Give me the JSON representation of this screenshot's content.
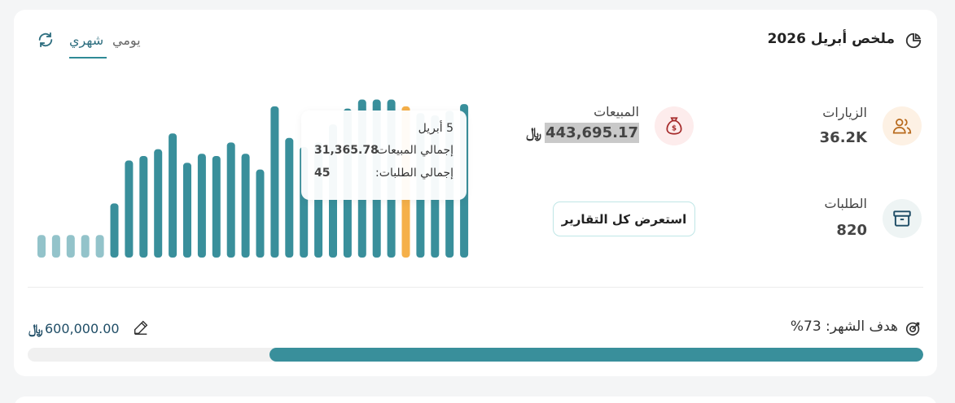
{
  "summary": {
    "title": "ملخص أبريل 2026",
    "tabs": [
      "يومي",
      "شهري"
    ],
    "active_tab": "شهري"
  },
  "stats": {
    "visits_label": "الزيارات",
    "visits_value": "36.2K",
    "sales_label": "المبيعات",
    "sales_value": "443,695.17",
    "orders_label": "الطلبات",
    "orders_value": "820"
  },
  "report_button_label": "استعرض كل التقارير",
  "tooltip": {
    "date": "5 أبريل",
    "sales_label": "إجمالي المبيعات:",
    "sales_value": "31,365.78",
    "orders_label": "إجمالي الطلبات:",
    "orders_value": "45"
  },
  "goal": {
    "label": "هدف الشهر: 73%",
    "amount": "600,000.00",
    "progress_percent": 73
  },
  "colors": {
    "accent": "#398f9b",
    "highlight_bar": "#f5b04a",
    "past_bar": "#93c3ca"
  },
  "chart_data": {
    "type": "bar",
    "categories": [],
    "values": [
      1,
      1,
      1,
      1,
      1,
      2.4,
      4.3,
      4.5,
      4.8,
      5.5,
      4.2,
      4.6,
      4.5,
      5.1,
      4.6,
      3.9,
      6.7,
      5.3,
      4.9,
      5.1,
      5.9,
      6.6,
      7.0,
      7.0,
      7.0,
      6.7,
      6.4,
      6.3,
      6.5,
      6.8
    ],
    "highlight_index": 25,
    "light_count": 5,
    "ylim": [
      0,
      7.2
    ],
    "xlabel": "",
    "ylabel": ""
  }
}
